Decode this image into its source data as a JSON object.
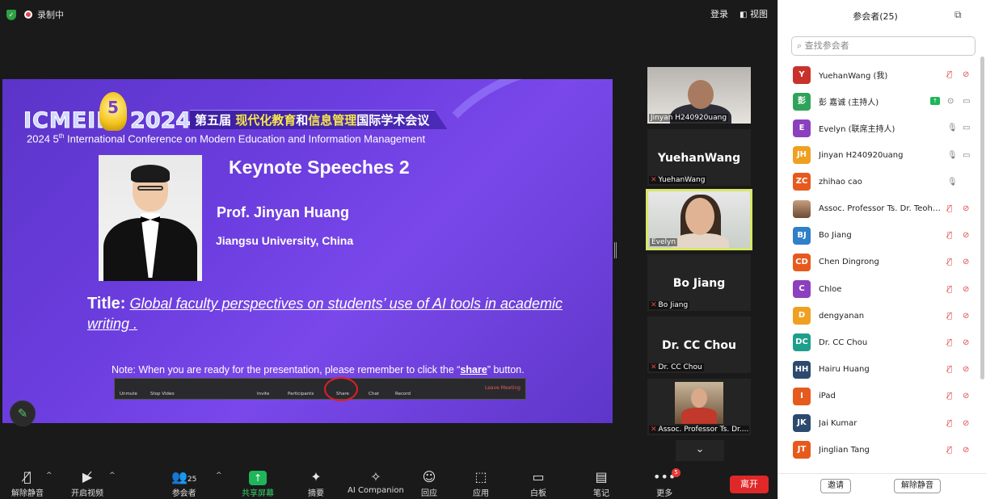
{
  "topbar": {
    "recording": "录制中",
    "login": "登录",
    "view": "视图"
  },
  "slide": {
    "logo": "ICMEIM",
    "logo_number": "5",
    "year": "2024",
    "cn_title_a": "第五届 ",
    "cn_title_b": "现代化教育",
    "cn_title_c": "和",
    "cn_title_d": "信息管理",
    "cn_title_e": "国际学术会议",
    "en_title_prefix": "2024 5",
    "en_title_sup": "th",
    "en_title_rest": " International Conference on Modern Education and Information Management",
    "keynote": "Keynote Speeches 2",
    "prof": "Prof. Jinyan Huang",
    "univ": "Jiangsu University, China",
    "title_label": "Title:",
    "talk_title": "Global faculty perspectives on students’ use of AI tools in academic writing .",
    "note_a": "Note: When you are ready for the presentation, please remember to click the “",
    "note_b": "share",
    "note_c": "” button.",
    "mini_toolbar": [
      "Unmute",
      "Stop Video",
      "Invite",
      "Participants",
      "Share",
      "Chat",
      "Record",
      "Leave Meeting"
    ]
  },
  "thumbnails": [
    {
      "name": "Jinyan H240920uang"
    },
    {
      "big": "YuehanWang",
      "name": "YuehanWang"
    },
    {
      "name": "Evelyn"
    },
    {
      "big": "Bo Jiang",
      "name": "Bo Jiang"
    },
    {
      "big": "Dr. CC Chou",
      "name": "Dr. CC Chou"
    },
    {
      "name": "Assoc. Professor Ts. Dr...."
    }
  ],
  "toolbar": {
    "unmute": "解除静音",
    "start_video": "开启视频",
    "participants": "参会者",
    "participants_count": "25",
    "share": "共享屏幕",
    "summary": "摘要",
    "ai": "AI Companion",
    "react": "回应",
    "apps": "应用",
    "whiteboard": "白板",
    "notes": "笔记",
    "more": "更多",
    "more_badge": "5",
    "leave": "离开"
  },
  "panel": {
    "title": "参会者(25)",
    "search_placeholder": "查找参会者",
    "participants": [
      {
        "initials": "Y",
        "name": "YuehanWang (我)",
        "color": "#c8322b"
      },
      {
        "initials": "彭",
        "name": "彭 嘉诚 (主持人)",
        "color": "#2fa35a"
      },
      {
        "initials": "E",
        "name": "Evelyn (联席主持人)",
        "color": "#8c3fbe"
      },
      {
        "initials": "JH",
        "name": "Jinyan H240920uang",
        "color": "#f0a020"
      },
      {
        "initials": "ZC",
        "name": "zhihao cao",
        "color": "#e65a1e"
      },
      {
        "initials": "",
        "name": "Assoc. Professor Ts. Dr. Teoh Ai ...",
        "color": "#8a6a55"
      },
      {
        "initials": "BJ",
        "name": "Bo Jiang",
        "color": "#2f7fc9"
      },
      {
        "initials": "CD",
        "name": "Chen Dingrong",
        "color": "#e65a1e"
      },
      {
        "initials": "C",
        "name": "Chloe",
        "color": "#8c3fbe"
      },
      {
        "initials": "D",
        "name": "dengyanan",
        "color": "#f0a020"
      },
      {
        "initials": "DC",
        "name": "Dr. CC Chou",
        "color": "#1e9e8c"
      },
      {
        "initials": "HH",
        "name": "Hairu Huang",
        "color": "#2c4a6e"
      },
      {
        "initials": "I",
        "name": "iPad",
        "color": "#e65a1e"
      },
      {
        "initials": "JK",
        "name": "Jai Kumar",
        "color": "#2c4a6e"
      },
      {
        "initials": "JT",
        "name": "Jinglian Tang",
        "color": "#e65a1e"
      }
    ],
    "invite": "邀请",
    "unmute_me": "解除静音"
  }
}
